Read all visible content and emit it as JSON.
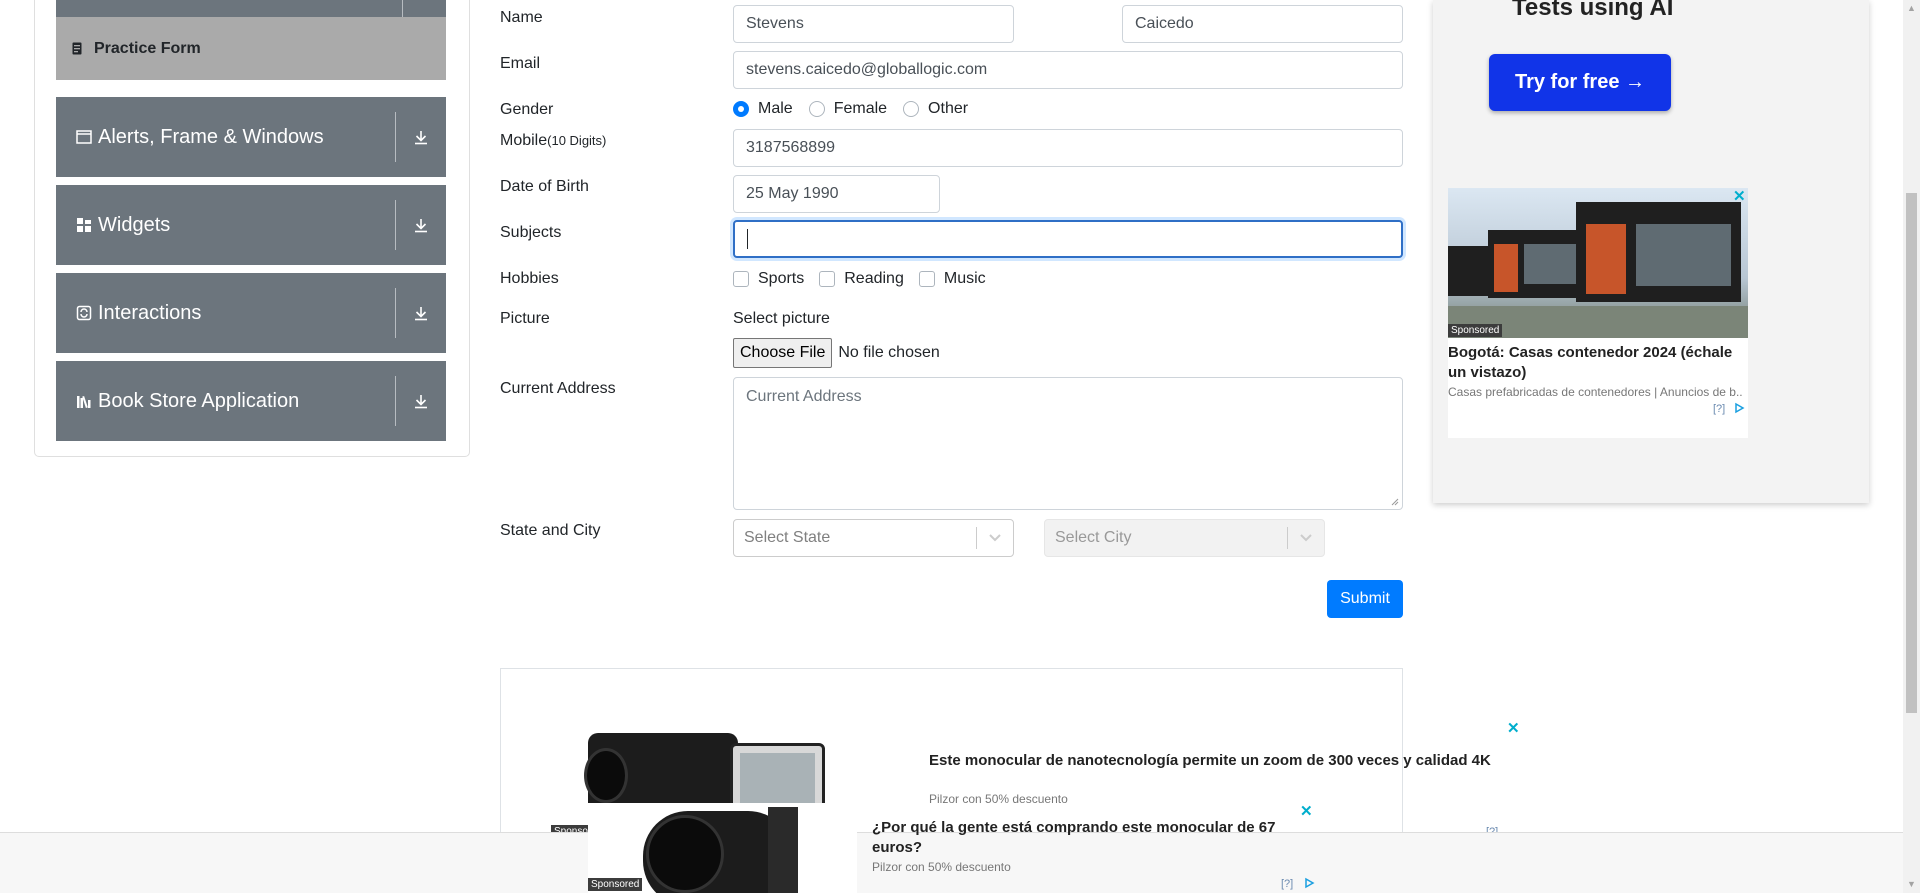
{
  "sidebar": {
    "practice_form": "Practice Form",
    "groups": [
      {
        "label": "Alerts, Frame & Windows",
        "icon": "window-icon"
      },
      {
        "label": "Widgets",
        "icon": "widgets-grid-icon"
      },
      {
        "label": "Interactions",
        "icon": "interactions-icon"
      },
      {
        "label": "Book Store Application",
        "icon": "books-icon"
      }
    ]
  },
  "form": {
    "name_label": "Name",
    "first_name": "Stevens",
    "last_name": "Caicedo",
    "email_label": "Email",
    "email": "stevens.caicedo@globallogic.com",
    "gender_label": "Gender",
    "genders": [
      "Male",
      "Female",
      "Other"
    ],
    "gender_selected": "Male",
    "mobile_label": "Mobile",
    "mobile_hint": "(10 Digits)",
    "mobile": "3187568899",
    "dob_label": "Date of Birth",
    "dob": "25 May 1990",
    "subjects_label": "Subjects",
    "hobbies_label": "Hobbies",
    "hobbies": [
      "Sports",
      "Reading",
      "Music"
    ],
    "picture_label": "Picture",
    "select_picture": "Select picture",
    "choose_file": "Choose File",
    "no_file": "No file chosen",
    "address_label": "Current Address",
    "address_placeholder": "Current Address",
    "state_city_label": "State and City",
    "state_placeholder": "Select State",
    "city_placeholder": "Select City",
    "submit": "Submit"
  },
  "ads": {
    "right_title": "Tests using AI",
    "try_button": "Try for free →",
    "card": {
      "sponsored": "Sponsored",
      "headline": "Bogotá: Casas contenedor 2024 (échale un vistazo)",
      "source": "Casas prefabricadas de contenedores | Anuncios de b...",
      "info": "[?]"
    },
    "bottom_top": {
      "headline": "Este monocular de nanotecnología permite un zoom de 300 veces y calidad 4K",
      "source": "Pilzor con 50% descuento",
      "sponsored": "Sponso",
      "info": "[?]"
    },
    "bottom_front": {
      "headline": "¿Por qué la gente está comprando este monocular de 67 euros?",
      "source": "Pilzor con 50% descuento",
      "sponsored": "Sponsored",
      "info": "[?]"
    }
  },
  "colors": {
    "sidebar_group": "#6c757d",
    "practice_active": "#aaaaaa",
    "primary": "#007bff",
    "ad_button": "#1134e8",
    "ad_close": "#00aecd"
  }
}
